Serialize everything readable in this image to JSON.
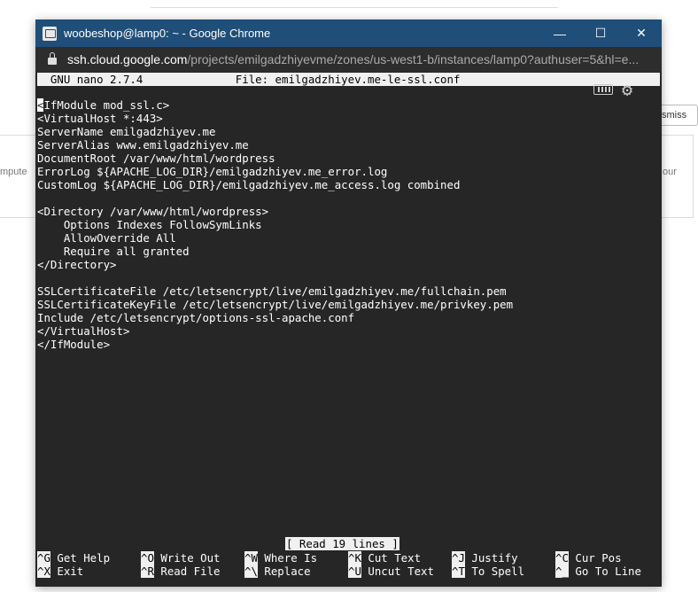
{
  "background": {
    "left_fragment": "mpute",
    "right_fragment": "our",
    "dismiss_label": "smiss"
  },
  "window": {
    "title": "woobeshop@lamp0: ~ - Google Chrome",
    "minimize": "—",
    "maximize": "☐",
    "close": "✕",
    "url_host": "ssh.cloud.google.com",
    "url_path": "/projects/emilgadzhiyevme/zones/us-west1-b/instances/lamp0?authuser=5&hl=e..."
  },
  "nano": {
    "header": "  GNU nano 2.7.4              File: emilgadzhiyev.me-le-ssl.conf",
    "status": "[ Read 19 lines ]",
    "lines": [
      "<IfModule mod_ssl.c>",
      "<VirtualHost *:443>",
      "ServerName emilgadzhiyev.me",
      "ServerAlias www.emilgadzhiyev.me",
      "DocumentRoot /var/www/html/wordpress",
      "ErrorLog ${APACHE_LOG_DIR}/emilgadzhiyev.me_error.log",
      "CustomLog ${APACHE_LOG_DIR}/emilgadzhiyev.me_access.log combined",
      "",
      "<Directory /var/www/html/wordpress>",
      "    Options Indexes FollowSymLinks",
      "    AllowOverride All",
      "    Require all granted",
      "</Directory>",
      "",
      "SSLCertificateFile /etc/letsencrypt/live/emilgadzhiyev.me/fullchain.pem",
      "SSLCertificateKeyFile /etc/letsencrypt/live/emilgadzhiyev.me/privkey.pem",
      "Include /etc/letsencrypt/options-ssl-apache.conf",
      "</VirtualHost>",
      "</IfModule>"
    ],
    "shortcuts_row1": [
      {
        "key": "^G",
        "label": " Get Help"
      },
      {
        "key": "^O",
        "label": " Write Out"
      },
      {
        "key": "^W",
        "label": " Where Is"
      },
      {
        "key": "^K",
        "label": " Cut Text"
      },
      {
        "key": "^J",
        "label": " Justify"
      },
      {
        "key": "^C",
        "label": " Cur Pos"
      }
    ],
    "shortcuts_row2": [
      {
        "key": "^X",
        "label": " Exit"
      },
      {
        "key": "^R",
        "label": " Read File"
      },
      {
        "key": "^\\",
        "label": " Replace"
      },
      {
        "key": "^U",
        "label": " Uncut Text"
      },
      {
        "key": "^T",
        "label": " To Spell"
      },
      {
        "key": "^_",
        "label": " Go To Line"
      }
    ]
  }
}
